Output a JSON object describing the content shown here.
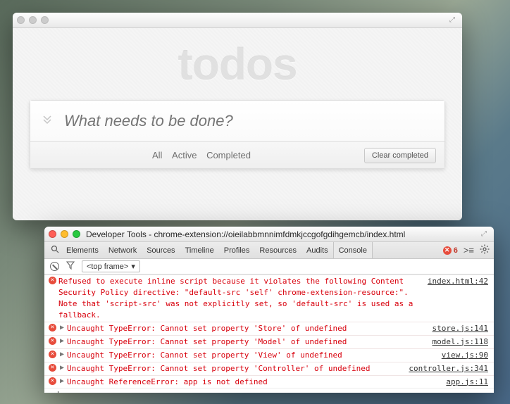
{
  "todo": {
    "title": "todos",
    "placeholder": "What needs to be done?",
    "filters": {
      "all": "All",
      "active": "Active",
      "completed": "Completed"
    },
    "clear": "Clear completed"
  },
  "devtools": {
    "window_title": "Developer Tools - chrome-extension://oieilabbmnnimfdmkjccgofgdihgemcb/index.html",
    "tabs": {
      "elements": "Elements",
      "network": "Network",
      "sources": "Sources",
      "timeline": "Timeline",
      "profiles": "Profiles",
      "resources": "Resources",
      "audits": "Audits",
      "console": "Console"
    },
    "error_count": "6",
    "frame_selector": "<top frame>",
    "errors": [
      {
        "msg": "Refused to execute inline script because it violates the following Content Security Policy directive: \"default-src 'self' chrome-extension-resource:\". Note that 'script-src' was not explicitly set, so 'default-src' is used as a fallback.",
        "loc": "index.html:42",
        "expandable": false
      },
      {
        "msg": "Uncaught TypeError: Cannot set property 'Store' of undefined",
        "loc": "store.js:141",
        "expandable": true
      },
      {
        "msg": "Uncaught TypeError: Cannot set property 'Model' of undefined",
        "loc": "model.js:118",
        "expandable": true
      },
      {
        "msg": "Uncaught TypeError: Cannot set property 'View' of undefined",
        "loc": "view.js:90",
        "expandable": true
      },
      {
        "msg": "Uncaught TypeError: Cannot set property 'Controller' of undefined",
        "loc": "controller.js:341",
        "expandable": true
      },
      {
        "msg": "Uncaught ReferenceError: app is not defined",
        "loc": "app.js:11",
        "expandable": true
      }
    ]
  }
}
